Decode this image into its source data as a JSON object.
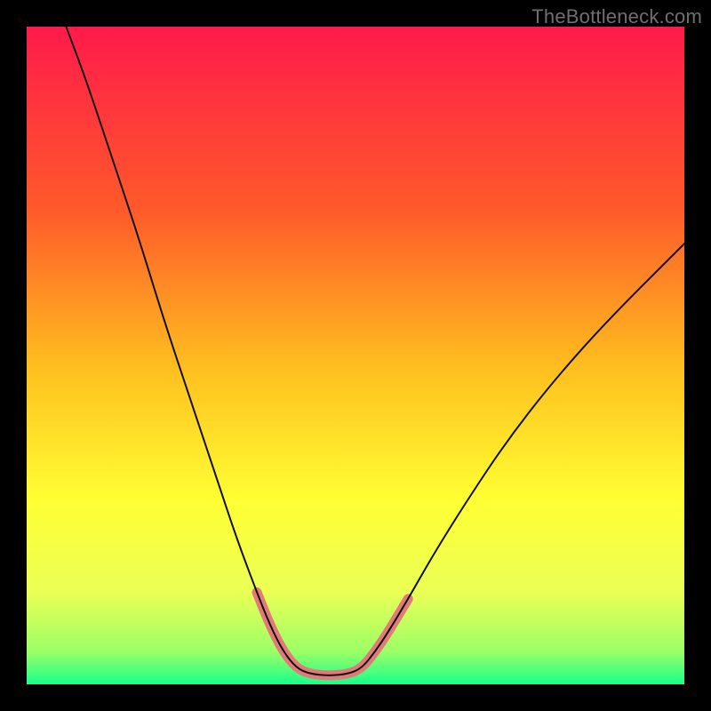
{
  "watermark": "TheBottleneck.com",
  "chart_data": {
    "type": "line",
    "title": "",
    "xlabel": "",
    "ylabel": "",
    "xlim": [
      0,
      100
    ],
    "ylim": [
      0,
      100
    ],
    "gradient_stops": [
      {
        "offset": 0,
        "color": "#ff1a4b"
      },
      {
        "offset": 28,
        "color": "#ff5a2a"
      },
      {
        "offset": 52,
        "color": "#ffbf1f"
      },
      {
        "offset": 72,
        "color": "#ffff33"
      },
      {
        "offset": 86,
        "color": "#eaff55"
      },
      {
        "offset": 95,
        "color": "#9cff66"
      },
      {
        "offset": 100,
        "color": "#18ff8c"
      }
    ],
    "series": [
      {
        "name": "main-curve",
        "color": "#111111",
        "stroke_width": 2,
        "points": [
          {
            "x": 6,
            "y": 100
          },
          {
            "x": 9,
            "y": 92
          },
          {
            "x": 13,
            "y": 80
          },
          {
            "x": 17,
            "y": 68
          },
          {
            "x": 21,
            "y": 55
          },
          {
            "x": 25,
            "y": 43
          },
          {
            "x": 29,
            "y": 31
          },
          {
            "x": 32,
            "y": 22
          },
          {
            "x": 35,
            "y": 14
          },
          {
            "x": 37,
            "y": 9
          },
          {
            "x": 39,
            "y": 5
          },
          {
            "x": 41,
            "y": 2.5
          },
          {
            "x": 43,
            "y": 1.6
          },
          {
            "x": 46,
            "y": 1.3
          },
          {
            "x": 49,
            "y": 1.6
          },
          {
            "x": 51,
            "y": 2.5
          },
          {
            "x": 53,
            "y": 5
          },
          {
            "x": 55,
            "y": 8
          },
          {
            "x": 58,
            "y": 13
          },
          {
            "x": 62,
            "y": 20
          },
          {
            "x": 67,
            "y": 28
          },
          {
            "x": 73,
            "y": 37
          },
          {
            "x": 80,
            "y": 46
          },
          {
            "x": 88,
            "y": 55
          },
          {
            "x": 100,
            "y": 67
          }
        ]
      },
      {
        "name": "highlight-segment",
        "color": "#e37a7a",
        "stroke_width": 11,
        "points": [
          {
            "x": 35,
            "y": 14
          },
          {
            "x": 37,
            "y": 9
          },
          {
            "x": 39,
            "y": 5
          },
          {
            "x": 41,
            "y": 2.5
          },
          {
            "x": 43,
            "y": 1.6
          },
          {
            "x": 46,
            "y": 1.3
          },
          {
            "x": 49,
            "y": 1.6
          },
          {
            "x": 51,
            "y": 2.5
          },
          {
            "x": 53,
            "y": 5
          },
          {
            "x": 55,
            "y": 8
          },
          {
            "x": 58,
            "y": 13
          }
        ]
      }
    ]
  }
}
